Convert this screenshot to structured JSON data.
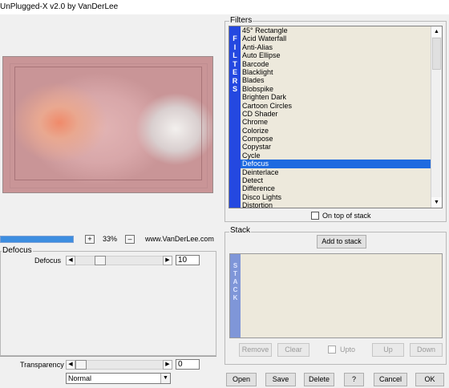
{
  "window": {
    "title": "UnPlugged-X v2.0 by VanDerLee"
  },
  "preview": {
    "zoom_in_label": "+",
    "zoom_label": "33%",
    "zoom_out_label": "–",
    "website": "www.VanDerLee.com",
    "progress_percent": 100
  },
  "defocus_group": {
    "title": "Defocus",
    "param_label": "Defocus",
    "param_value": "10",
    "param_fraction": 0.25
  },
  "transparency": {
    "label": "Transparency",
    "value": "0",
    "blend_mode": "Normal"
  },
  "filters": {
    "group_title": "Filters",
    "strip_letters": [
      "F",
      "I",
      "L",
      "T",
      "E",
      "R",
      "S"
    ],
    "items": [
      "45° Rectangle",
      "Acid Waterfall",
      "Anti-Alias",
      "Auto Ellipse",
      "Barcode",
      "Blacklight",
      "Blades",
      "Blobspike",
      "Brighten Dark",
      "Cartoon Circles",
      "CD Shader",
      "Chrome",
      "Colorize",
      "Compose",
      "Copystar",
      "Cycle",
      "Defocus",
      "Deinterlace",
      "Detect",
      "Difference",
      "Disco Lights",
      "Distortion"
    ],
    "selected": "Defocus",
    "on_top_label": "On top of stack"
  },
  "stack": {
    "group_title": "Stack",
    "add_label": "Add to stack",
    "strip_letters": [
      "S",
      "T",
      "A",
      "C",
      "K"
    ],
    "remove_label": "Remove",
    "clear_label": "Clear",
    "upto_label": "Upto",
    "up_label": "Up",
    "down_label": "Down"
  },
  "footer": {
    "open_label": "Open",
    "save_label": "Save",
    "delete_label": "Delete",
    "help_label": "?",
    "cancel_label": "Cancel",
    "ok_label": "OK"
  },
  "colors": {
    "filter_strip": "#2448e0",
    "selection": "#1e6ae0",
    "stack_strip": "#7f96d8",
    "list_background": "#ede9dc"
  }
}
